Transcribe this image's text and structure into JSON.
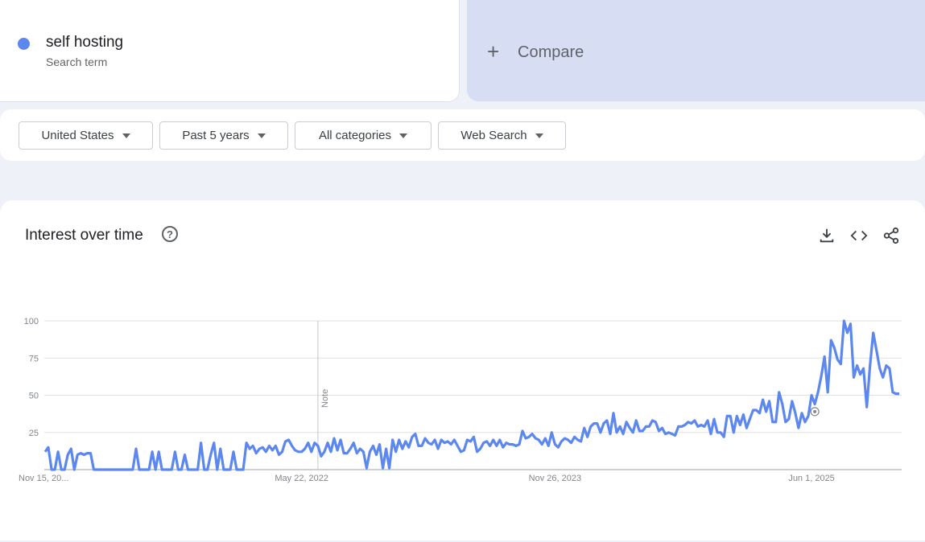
{
  "term": {
    "name": "self hosting",
    "subtitle": "Search term",
    "color": "#5b87ef"
  },
  "compare": {
    "label": "Compare",
    "icon": "plus-icon"
  },
  "filters": {
    "region": "United States",
    "period": "Past 5 years",
    "category": "All categories",
    "search_type": "Web Search"
  },
  "panel": {
    "title": "Interest over time",
    "icons": [
      "help-icon",
      "download-icon",
      "embed-code-icon",
      "share-icon"
    ]
  },
  "chart_data": {
    "type": "line",
    "title": "Interest over time",
    "x_tick_labels": [
      "Nov 15, 20...",
      "May 22, 2022",
      "Nov 26, 2023",
      "Jun 1, 2025"
    ],
    "y_tick_labels": [
      "100",
      "75",
      "50",
      "25"
    ],
    "ylim": [
      0,
      100
    ],
    "grid": true,
    "annotation": {
      "label": "Note"
    },
    "series": [
      {
        "color": "#5b87ef",
        "x_start": "Nov 15, 2020",
        "interval": "weekly",
        "values": [
          12,
          15,
          0,
          0,
          12,
          0,
          0,
          10,
          14,
          0,
          10,
          11,
          10,
          11,
          11,
          0,
          0,
          0,
          0,
          0,
          0,
          0,
          0,
          0,
          0,
          0,
          0,
          0,
          14,
          0,
          0,
          0,
          0,
          12,
          0,
          12,
          0,
          0,
          0,
          0,
          12,
          0,
          0,
          10,
          0,
          0,
          0,
          0,
          18,
          0,
          0,
          10,
          18,
          0,
          14,
          0,
          0,
          0,
          12,
          0,
          0,
          0,
          18,
          14,
          16,
          11,
          14,
          15,
          12,
          16,
          13,
          16,
          10,
          12,
          19,
          20,
          16,
          13,
          12,
          12,
          14,
          18,
          12,
          18,
          16,
          9,
          12,
          18,
          12,
          21,
          13,
          20,
          11,
          11,
          14,
          18,
          11,
          14,
          12,
          1,
          12,
          16,
          10,
          17,
          1,
          14,
          1,
          20,
          12,
          20,
          14,
          19,
          15,
          22,
          24,
          16,
          16,
          21,
          18,
          17,
          20,
          14,
          20,
          18,
          19,
          17,
          20,
          16,
          12,
          13,
          20,
          19,
          22,
          12,
          14,
          18,
          19,
          16,
          20,
          16,
          20,
          15,
          18,
          17,
          17,
          16,
          17,
          26,
          21,
          22,
          24,
          21,
          20,
          17,
          21,
          16,
          25,
          17,
          15,
          19,
          21,
          20,
          18,
          22,
          20,
          19,
          28,
          22,
          29,
          31,
          31,
          25,
          31,
          33,
          24,
          38,
          25,
          29,
          24,
          32,
          28,
          25,
          33,
          26,
          26,
          29,
          29,
          33,
          32,
          26,
          28,
          24,
          25,
          24,
          23,
          29,
          29,
          30,
          32,
          31,
          33,
          29,
          30,
          29,
          33,
          24,
          34,
          25,
          25,
          22,
          36,
          36,
          25,
          36,
          30,
          37,
          28,
          34,
          40,
          40,
          38,
          47,
          39,
          46,
          32,
          32,
          52,
          44,
          32,
          34,
          46,
          38,
          28,
          38,
          32,
          36,
          50,
          44,
          52,
          63,
          76,
          52,
          87,
          82,
          74,
          71,
          100,
          92,
          98,
          62,
          70,
          64,
          68,
          42,
          70,
          92,
          80,
          68,
          62,
          70,
          68,
          52,
          51,
          51
        ]
      }
    ]
  }
}
